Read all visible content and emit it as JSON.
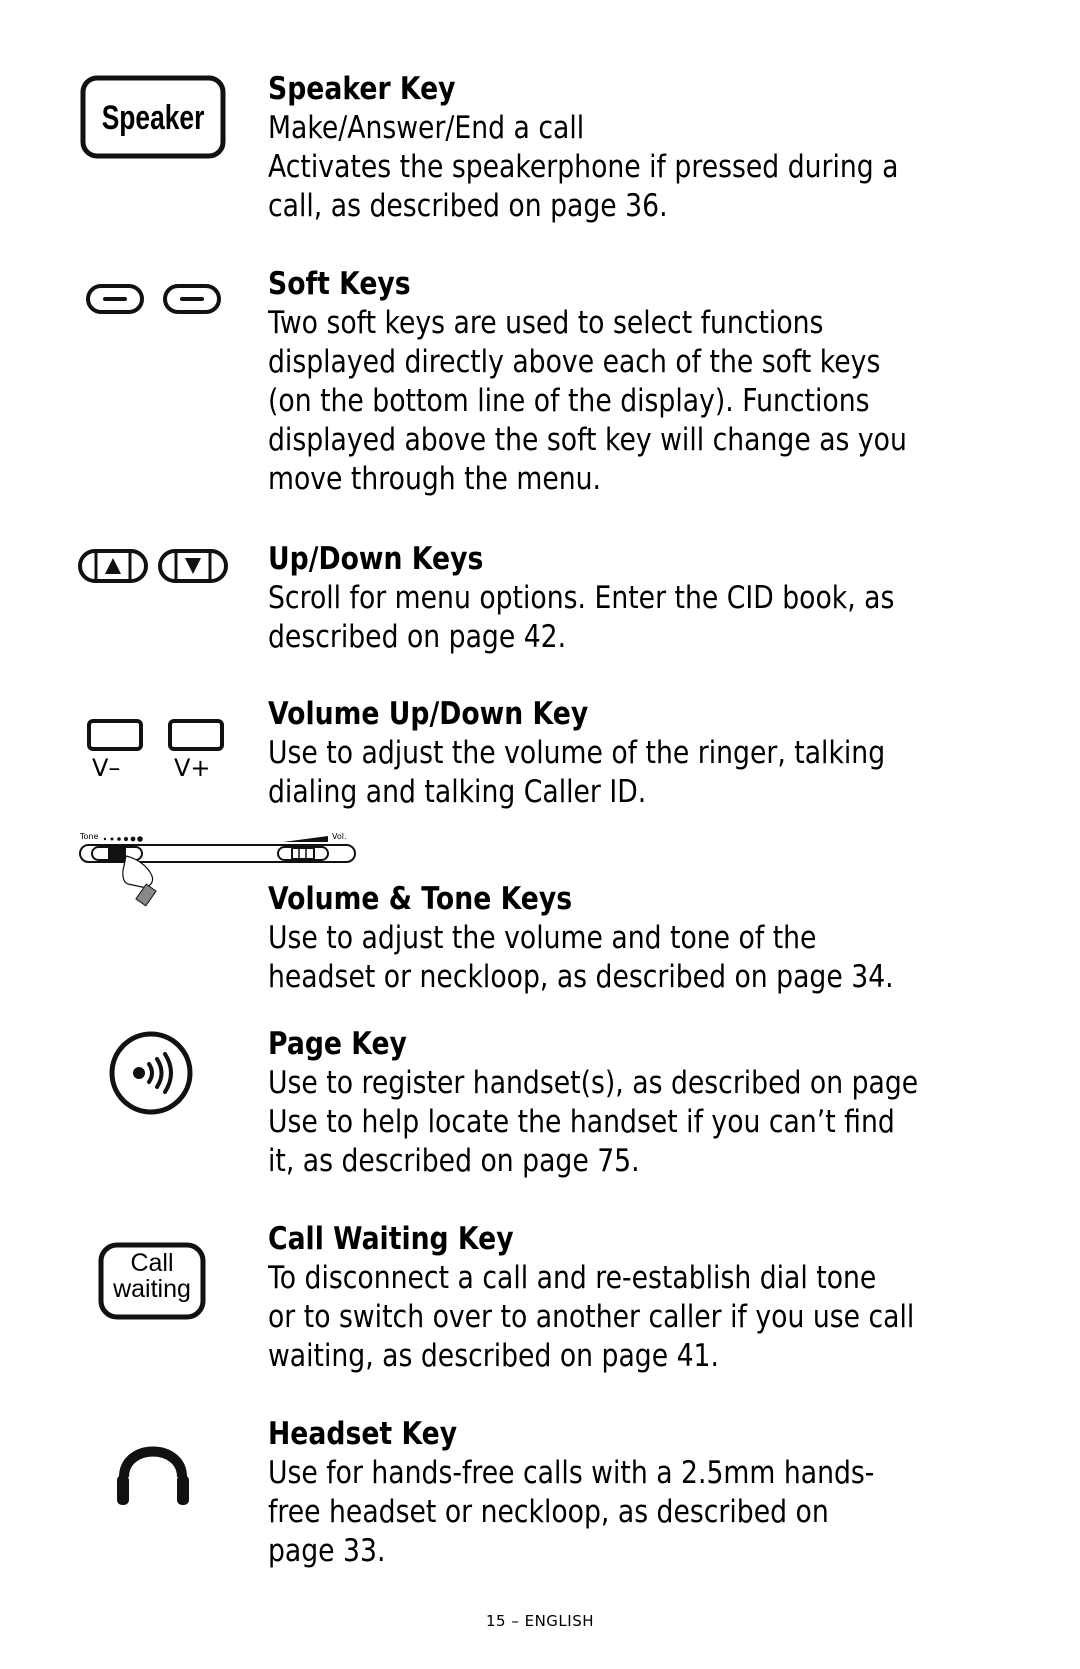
{
  "sections": [
    {
      "icon": "speaker-key-icon",
      "icon_label": "Speaker",
      "title": "Speaker Key",
      "lines": [
        "Make/Answer/End a call",
        "Activates the speakerphone if pressed during a",
        "call, as described on page 36."
      ]
    },
    {
      "icon": "soft-keys-icon",
      "title": "Soft Keys",
      "lines": [
        "Two soft keys are used to select functions",
        "displayed directly above each of the soft keys",
        "(on the bottom line of the display).  Functions",
        "displayed above the soft key will change as you",
        "move through the menu."
      ]
    },
    {
      "icon": "up-down-keys-icon",
      "title": "Up/Down Keys",
      "lines": [
        "Scroll for menu options. Enter the CID book, as",
        "described on page 42."
      ]
    },
    {
      "icon": "volume-keys-icon",
      "icon_labels": [
        "V–",
        "V+"
      ],
      "title": "Volume Up/Down Key",
      "lines": [
        "Use to adjust the volume of the ringer, talking",
        "dialing and talking Caller ID."
      ]
    },
    {
      "icon": "volume-tone-slider-icon",
      "icon_labels": [
        "Tone",
        "Vol."
      ],
      "title": "Volume & Tone Keys",
      "lines": [
        "Use to adjust the volume and tone of the",
        "headset or neckloop, as described on page 34."
      ]
    },
    {
      "icon": "page-key-icon",
      "title": "Page Key",
      "lines": [
        "Use to register handset(s), as described on page",
        "Use to help locate the handset if you can’t find",
        "it, as described on page 75."
      ]
    },
    {
      "icon": "call-waiting-key-icon",
      "icon_label": [
        "Call",
        "waiting"
      ],
      "title": "Call Waiting Key",
      "lines": [
        "To disconnect a call and re-establish dial tone",
        "or to switch over to another caller if you use call",
        "waiting, as described on page 41."
      ]
    },
    {
      "icon": "headset-key-icon",
      "title": "Headset Key",
      "lines": [
        "Use for hands-free calls with a 2.5mm hands-",
        "free headset or neckloop, as described on",
        "page 33."
      ]
    }
  ],
  "footer": "15 – ENGLISH"
}
